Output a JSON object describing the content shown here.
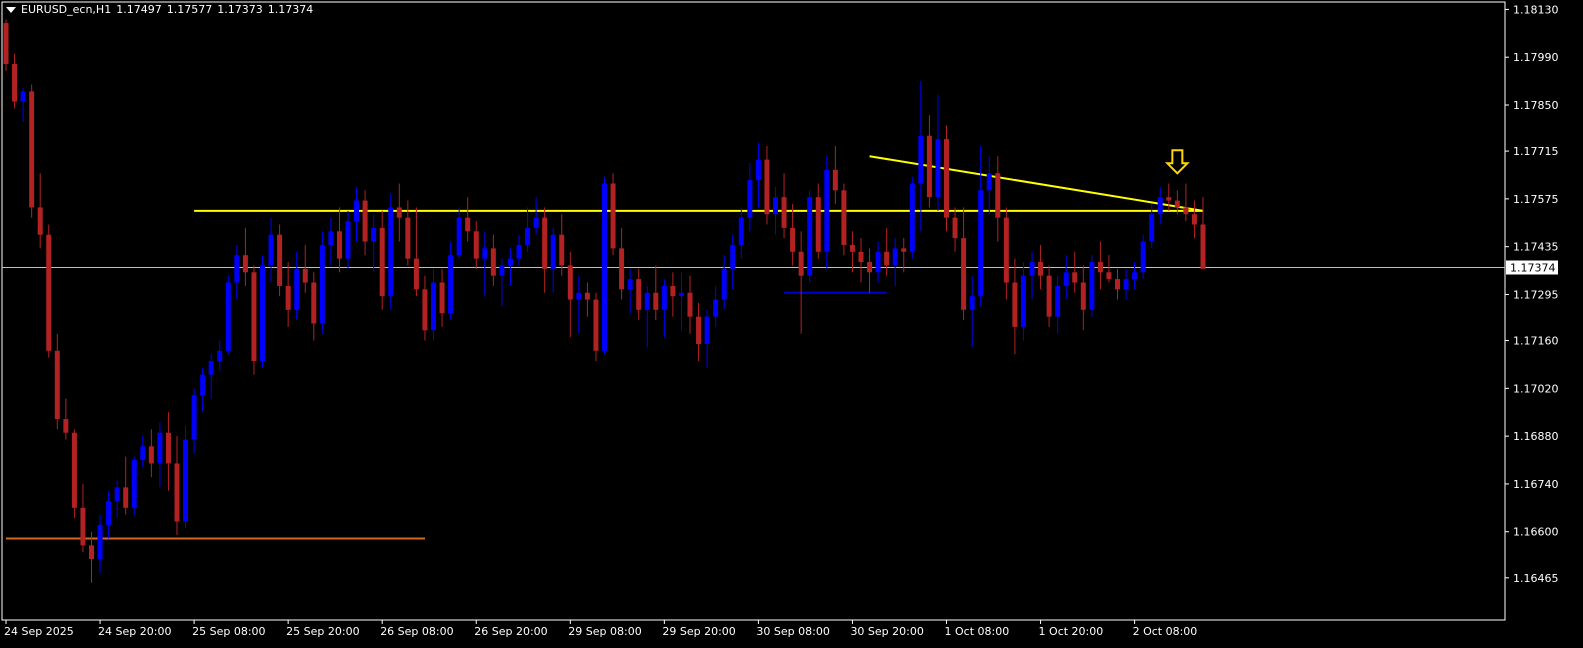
{
  "header": {
    "symbol": "EURUSD_ecn,H1",
    "ohlc": [
      "1.17497",
      "1.17577",
      "1.17373",
      "1.17374"
    ]
  },
  "price_axis": {
    "current_price_label": "1.17374"
  },
  "colors": {
    "background": "#000000",
    "bull_candle": "#0000ff",
    "bear_candle": "#b22222",
    "axis": "#ffffff",
    "trendline": "#ffff00",
    "support_line": "#d2691e",
    "range_line": "#0000cd",
    "current_price_line": "#c0c0c0",
    "arrow": "#ffd700"
  },
  "chart_data": {
    "type": "candlestick",
    "symbol": "EURUSD_ecn",
    "timeframe": "H1",
    "ylim": [
      1.164,
      1.1814
    ],
    "y_ticks": [
      "1.18130",
      "1.17990",
      "1.17850",
      "1.17715",
      "1.17575",
      "1.17435",
      "1.17295",
      "1.17160",
      "1.17020",
      "1.16880",
      "1.16740",
      "1.16600",
      "1.16465"
    ],
    "x_ticks": [
      "24 Sep 2025",
      "24 Sep 20:00",
      "25 Sep 08:00",
      "25 Sep 20:00",
      "26 Sep 08:00",
      "26 Sep 20:00",
      "29 Sep 08:00",
      "29 Sep 20:00",
      "30 Sep 08:00",
      "30 Sep 20:00",
      "1 Oct 08:00",
      "1 Oct 20:00",
      "2 Oct 08:00"
    ],
    "candles": [
      [
        1.1809,
        1.181,
        1.1795,
        1.1797
      ],
      [
        1.1797,
        1.18,
        1.1784,
        1.1786
      ],
      [
        1.1786,
        1.179,
        1.178,
        1.1789
      ],
      [
        1.1789,
        1.1791,
        1.1752,
        1.1755
      ],
      [
        1.1755,
        1.1765,
        1.1743,
        1.1747
      ],
      [
        1.1747,
        1.175,
        1.1711,
        1.1713
      ],
      [
        1.1713,
        1.1718,
        1.169,
        1.1693
      ],
      [
        1.1693,
        1.1699,
        1.1687,
        1.1689
      ],
      [
        1.1689,
        1.169,
        1.1664,
        1.1667
      ],
      [
        1.1667,
        1.1674,
        1.1654,
        1.1656
      ],
      [
        1.1656,
        1.166,
        1.1645,
        1.1652
      ],
      [
        1.1652,
        1.1665,
        1.1648,
        1.1662
      ],
      [
        1.1662,
        1.1672,
        1.1658,
        1.1669
      ],
      [
        1.1669,
        1.1675,
        1.1664,
        1.1673
      ],
      [
        1.1673,
        1.1682,
        1.1665,
        1.1667
      ],
      [
        1.1667,
        1.1682,
        1.1665,
        1.1681
      ],
      [
        1.1681,
        1.1688,
        1.1679,
        1.1685
      ],
      [
        1.1685,
        1.169,
        1.1676,
        1.168
      ],
      [
        1.168,
        1.1692,
        1.1673,
        1.1689
      ],
      [
        1.1689,
        1.1695,
        1.1672,
        1.168
      ],
      [
        1.168,
        1.1688,
        1.1659,
        1.1663
      ],
      [
        1.1663,
        1.1691,
        1.1661,
        1.1687
      ],
      [
        1.1687,
        1.1702,
        1.1683,
        1.17
      ],
      [
        1.17,
        1.1708,
        1.1695,
        1.1706
      ],
      [
        1.1706,
        1.1712,
        1.1699,
        1.171
      ],
      [
        1.171,
        1.1716,
        1.1707,
        1.1713
      ],
      [
        1.1713,
        1.1735,
        1.1712,
        1.1733
      ],
      [
        1.1733,
        1.1744,
        1.1728,
        1.1741
      ],
      [
        1.1741,
        1.1749,
        1.1732,
        1.1736
      ],
      [
        1.1736,
        1.1738,
        1.1706,
        1.171
      ],
      [
        1.171,
        1.1741,
        1.1708,
        1.1738
      ],
      [
        1.1738,
        1.1752,
        1.1733,
        1.1747
      ],
      [
        1.1747,
        1.175,
        1.1729,
        1.1732
      ],
      [
        1.1732,
        1.1739,
        1.172,
        1.1725
      ],
      [
        1.1725,
        1.1742,
        1.1722,
        1.1737
      ],
      [
        1.1737,
        1.1744,
        1.173,
        1.1733
      ],
      [
        1.1733,
        1.1736,
        1.1716,
        1.1721
      ],
      [
        1.1721,
        1.1748,
        1.1718,
        1.1744
      ],
      [
        1.1744,
        1.1752,
        1.1738,
        1.1748
      ],
      [
        1.1748,
        1.1755,
        1.1736,
        1.174
      ],
      [
        1.174,
        1.1754,
        1.1737,
        1.1751
      ],
      [
        1.1751,
        1.1761,
        1.1745,
        1.1757
      ],
      [
        1.1757,
        1.176,
        1.1741,
        1.1745
      ],
      [
        1.1745,
        1.1753,
        1.1736,
        1.1749
      ],
      [
        1.1749,
        1.1754,
        1.1725,
        1.1729
      ],
      [
        1.1729,
        1.1759,
        1.1725,
        1.1755
      ],
      [
        1.1755,
        1.1762,
        1.1745,
        1.1752
      ],
      [
        1.1752,
        1.1757,
        1.1738,
        1.174
      ],
      [
        1.174,
        1.1755,
        1.1729,
        1.1731
      ],
      [
        1.1731,
        1.1735,
        1.1716,
        1.1719
      ],
      [
        1.1719,
        1.1737,
        1.1716,
        1.1733
      ],
      [
        1.1733,
        1.1737,
        1.172,
        1.1724
      ],
      [
        1.1724,
        1.1745,
        1.1722,
        1.1741
      ],
      [
        1.1741,
        1.1755,
        1.174,
        1.1752
      ],
      [
        1.1752,
        1.1758,
        1.1745,
        1.1748
      ],
      [
        1.1748,
        1.1751,
        1.1737,
        1.174
      ],
      [
        1.174,
        1.1748,
        1.1729,
        1.1743
      ],
      [
        1.1743,
        1.1747,
        1.1732,
        1.1735
      ],
      [
        1.1735,
        1.174,
        1.1726,
        1.1738
      ],
      [
        1.1738,
        1.1743,
        1.1732,
        1.174
      ],
      [
        1.174,
        1.1747,
        1.1738,
        1.1744
      ],
      [
        1.1744,
        1.1755,
        1.1742,
        1.1749
      ],
      [
        1.1749,
        1.1758,
        1.1747,
        1.1752
      ],
      [
        1.1752,
        1.1755,
        1.173,
        1.1737
      ],
      [
        1.1737,
        1.1749,
        1.173,
        1.1747
      ],
      [
        1.1747,
        1.1753,
        1.1735,
        1.1738
      ],
      [
        1.1738,
        1.1742,
        1.1717,
        1.1728
      ],
      [
        1.1728,
        1.1735,
        1.1718,
        1.173
      ],
      [
        1.173,
        1.1733,
        1.1723,
        1.1728
      ],
      [
        1.1728,
        1.173,
        1.171,
        1.1713
      ],
      [
        1.1713,
        1.1764,
        1.1712,
        1.1762
      ],
      [
        1.1762,
        1.1765,
        1.1741,
        1.1743
      ],
      [
        1.1743,
        1.1749,
        1.1728,
        1.1731
      ],
      [
        1.1731,
        1.1737,
        1.1724,
        1.1734
      ],
      [
        1.1734,
        1.1737,
        1.1722,
        1.1725
      ],
      [
        1.1725,
        1.1732,
        1.1714,
        1.173
      ],
      [
        1.173,
        1.1738,
        1.1722,
        1.1725
      ],
      [
        1.1725,
        1.1734,
        1.1717,
        1.1732
      ],
      [
        1.1732,
        1.1736,
        1.1723,
        1.1729
      ],
      [
        1.1729,
        1.1736,
        1.1719,
        1.173
      ],
      [
        1.173,
        1.1735,
        1.1718,
        1.1723
      ],
      [
        1.1723,
        1.1727,
        1.171,
        1.1715
      ],
      [
        1.1715,
        1.1725,
        1.1708,
        1.1723
      ],
      [
        1.1723,
        1.1732,
        1.172,
        1.1728
      ],
      [
        1.1728,
        1.1741,
        1.1725,
        1.1737
      ],
      [
        1.1737,
        1.1747,
        1.1731,
        1.1744
      ],
      [
        1.1744,
        1.1755,
        1.174,
        1.1752
      ],
      [
        1.1752,
        1.1768,
        1.1748,
        1.1763
      ],
      [
        1.1763,
        1.1774,
        1.1755,
        1.1769
      ],
      [
        1.1769,
        1.1773,
        1.175,
        1.1753
      ],
      [
        1.1753,
        1.1761,
        1.1747,
        1.1758
      ],
      [
        1.1758,
        1.1765,
        1.1746,
        1.1749
      ],
      [
        1.1749,
        1.1756,
        1.1738,
        1.1742
      ],
      [
        1.1742,
        1.1748,
        1.1718,
        1.1735
      ],
      [
        1.1735,
        1.176,
        1.1733,
        1.1758
      ],
      [
        1.1758,
        1.1762,
        1.174,
        1.1742
      ],
      [
        1.1742,
        1.177,
        1.1737,
        1.1766
      ],
      [
        1.1766,
        1.1773,
        1.1756,
        1.176
      ],
      [
        1.176,
        1.1762,
        1.1741,
        1.1744
      ],
      [
        1.1744,
        1.1748,
        1.1736,
        1.1742
      ],
      [
        1.1742,
        1.1746,
        1.1733,
        1.1739
      ],
      [
        1.1739,
        1.1743,
        1.173,
        1.1736
      ],
      [
        1.1736,
        1.1745,
        1.1733,
        1.1742
      ],
      [
        1.1742,
        1.1749,
        1.1735,
        1.1738
      ],
      [
        1.1738,
        1.1746,
        1.1732,
        1.1743
      ],
      [
        1.1743,
        1.1746,
        1.1736,
        1.1742
      ],
      [
        1.1742,
        1.1764,
        1.174,
        1.1762
      ],
      [
        1.1762,
        1.1792,
        1.1748,
        1.1776
      ],
      [
        1.1776,
        1.1782,
        1.1755,
        1.1758
      ],
      [
        1.1758,
        1.1788,
        1.1754,
        1.1775
      ],
      [
        1.1775,
        1.1779,
        1.1748,
        1.1752
      ],
      [
        1.1752,
        1.1755,
        1.1742,
        1.1746
      ],
      [
        1.1746,
        1.1755,
        1.1722,
        1.1725
      ],
      [
        1.1725,
        1.1735,
        1.1714,
        1.1729
      ],
      [
        1.1729,
        1.1773,
        1.1726,
        1.176
      ],
      [
        1.176,
        1.177,
        1.1753,
        1.1765
      ],
      [
        1.1765,
        1.177,
        1.1745,
        1.1752
      ],
      [
        1.1752,
        1.1755,
        1.1728,
        1.1733
      ],
      [
        1.1733,
        1.174,
        1.1712,
        1.172
      ],
      [
        1.172,
        1.1739,
        1.1716,
        1.1735
      ],
      [
        1.1735,
        1.1742,
        1.1728,
        1.1739
      ],
      [
        1.1739,
        1.1744,
        1.1731,
        1.1735
      ],
      [
        1.1735,
        1.1738,
        1.172,
        1.1723
      ],
      [
        1.1723,
        1.1735,
        1.1718,
        1.1732
      ],
      [
        1.1732,
        1.1741,
        1.1728,
        1.1736
      ],
      [
        1.1736,
        1.1742,
        1.173,
        1.1733
      ],
      [
        1.1733,
        1.1738,
        1.1719,
        1.1725
      ],
      [
        1.1725,
        1.1741,
        1.1723,
        1.1739
      ],
      [
        1.1739,
        1.1745,
        1.1731,
        1.1736
      ],
      [
        1.1736,
        1.1741,
        1.1733,
        1.1734
      ],
      [
        1.1734,
        1.1737,
        1.1728,
        1.1731
      ],
      [
        1.1731,
        1.1737,
        1.1728,
        1.1734
      ],
      [
        1.1734,
        1.1739,
        1.1731,
        1.1736
      ],
      [
        1.1736,
        1.1747,
        1.1734,
        1.1745
      ],
      [
        1.1745,
        1.1756,
        1.1743,
        1.1753
      ],
      [
        1.1753,
        1.1761,
        1.175,
        1.1758
      ],
      [
        1.1758,
        1.1762,
        1.1754,
        1.1757
      ],
      [
        1.1757,
        1.176,
        1.1753,
        1.1755
      ],
      [
        1.1755,
        1.1762,
        1.1751,
        1.1753
      ],
      [
        1.1753,
        1.1757,
        1.1746,
        1.175
      ],
      [
        1.175,
        1.1758,
        1.1737,
        1.1737
      ]
    ],
    "annotations": [
      {
        "type": "horizontal_line",
        "price": 1.1754,
        "from_bar": 22,
        "to_bar": 140,
        "color": "yellow"
      },
      {
        "type": "trendline",
        "from": {
          "bar": 101,
          "price": 1.177
        },
        "to": {
          "bar": 140,
          "price": 1.1754
        },
        "color": "yellow"
      },
      {
        "type": "horizontal_line",
        "price": 1.1658,
        "from_bar": 0,
        "to_bar": 49,
        "color": "orange"
      },
      {
        "type": "horizontal_line",
        "price": 1.173,
        "from_bar": 91,
        "to_bar": 103,
        "color": "blue"
      },
      {
        "type": "arrow_down",
        "bar": 137,
        "price": 1.1765,
        "color": "gold"
      },
      {
        "type": "current_price_line",
        "price": 1.17374
      }
    ]
  }
}
